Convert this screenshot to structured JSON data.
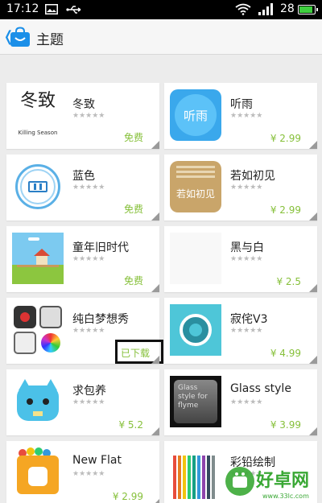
{
  "status_bar": {
    "time": "17:12",
    "battery_level": "28",
    "icons": [
      "image-icon",
      "usb-icon",
      "wifi-icon",
      "signal-icon",
      "battery-icon"
    ]
  },
  "header": {
    "title": "主题",
    "icon": "shopping-bag-icon",
    "back_icon": "back-icon"
  },
  "themes": [
    {
      "name": "冬致",
      "price": "免费",
      "rating_stars": "★★★★★",
      "thumb_text": "冬致",
      "thumb_sub": "Killing Season"
    },
    {
      "name": "听雨",
      "price": "¥ 2.99",
      "rating_stars": "★★★★★",
      "thumb_text": "听雨"
    },
    {
      "name": "蓝色",
      "price": "免费",
      "rating_stars": "★★★★★"
    },
    {
      "name": "若如初见",
      "price": "¥ 2.99",
      "rating_stars": "★★★★★",
      "thumb_text": "若如初见"
    },
    {
      "name": "童年旧时代",
      "price": "免费",
      "rating_stars": "★★★★★"
    },
    {
      "name": "黑与白",
      "price": "¥ 2.5",
      "rating_stars": "★★★★★"
    },
    {
      "name": "纯白梦想秀",
      "price": "已下载",
      "rating_stars": "★★★★★"
    },
    {
      "name": "寂侘V3",
      "price": "¥ 4.99",
      "rating_stars": "★★★★★"
    },
    {
      "name": "求包养",
      "price": "¥ 5.2",
      "rating_stars": "★★★★★"
    },
    {
      "name": "Glass style",
      "price": "¥ 3.99",
      "rating_stars": "★★★★★",
      "thumb_text": "Glass style for flyme"
    },
    {
      "name": "New Flat",
      "price": "¥ 2.99",
      "rating_stars": "★★★★★"
    },
    {
      "name": "彩铅绘制",
      "price": "",
      "rating_stars": "★★★★★"
    }
  ],
  "watermark": {
    "main": "好卓网",
    "url": "www.33lc.com"
  },
  "colors": {
    "accent_blue": "#1b8fe8",
    "price_green": "#86c03a",
    "background": "#ececec"
  }
}
